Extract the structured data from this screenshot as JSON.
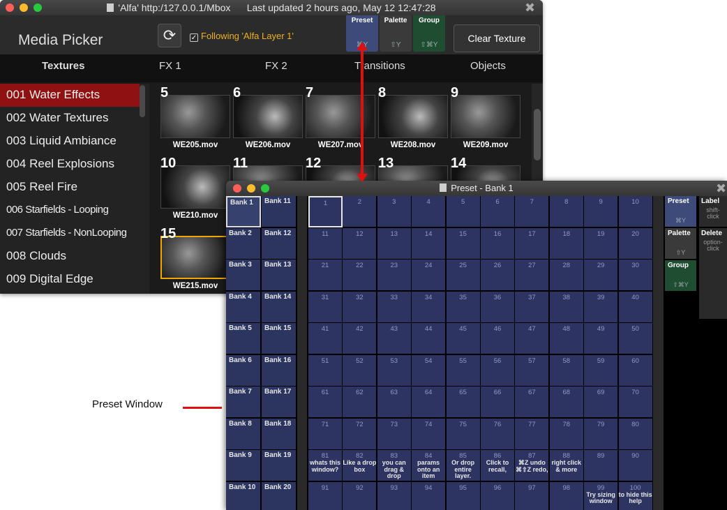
{
  "media_picker": {
    "window_title": "'Alfa' http:/127.0.0.1/Mbox      Last updated 2 hours ago, May 12 12:47:28",
    "app_title": "Media Picker",
    "following_label": "Following 'Alfa Layer 1'",
    "mode_buttons": [
      {
        "label": "Preset",
        "shortcut": "⌘Y",
        "color": "#2e3461"
      },
      {
        "label": "Palette",
        "shortcut": "⇧Y",
        "color": "#3a3a3a"
      },
      {
        "label": "Group",
        "shortcut": "⇧⌘Y",
        "color": "#1f4d32"
      }
    ],
    "clear_button": "Clear Texture",
    "tabs": [
      "Textures",
      "FX 1",
      "FX 2",
      "Transitions",
      "Objects"
    ],
    "sidebar": [
      "001  Water Effects",
      "002  Water Textures",
      "003  Liquid Ambiance",
      "004  Reel Explosions",
      "005  Reel Fire",
      "006  Starfields - Looping",
      "007  Starfields - NonLooping",
      "008  Clouds",
      "009  Digital Edge"
    ],
    "thumbnails": [
      {
        "num": "5",
        "file": "WE205.mov"
      },
      {
        "num": "6",
        "file": "WE206.mov"
      },
      {
        "num": "7",
        "file": "WE207.mov"
      },
      {
        "num": "8",
        "file": "WE208.mov"
      },
      {
        "num": "9",
        "file": "WE209.mov"
      },
      {
        "num": "10",
        "file": "WE210.mov"
      },
      {
        "num": "11",
        "file": ""
      },
      {
        "num": "12",
        "file": ""
      },
      {
        "num": "13",
        "file": ""
      },
      {
        "num": "14",
        "file": ""
      },
      {
        "num": "15",
        "file": "WE215.mov"
      }
    ]
  },
  "preset_window": {
    "title": "Preset - Bank 1",
    "banks_left": [
      "Bank 1",
      "Bank 2",
      "Bank 3",
      "Bank 4",
      "Bank 5",
      "Bank 6",
      "Bank 7",
      "Bank 8",
      "Bank 9",
      "Bank 10"
    ],
    "banks_right": [
      "Bank 11",
      "Bank 12",
      "Bank 13",
      "Bank 14",
      "Bank 15",
      "Bank 16",
      "Bank 17",
      "Bank 18",
      "Bank 19",
      "Bank 20"
    ],
    "help_texts": {
      "81": "whats this window?",
      "82": "Like a drop box",
      "83": "you can drag & drop",
      "84": "params onto an item",
      "85": "Or drop entire layer.",
      "86": "Click to recall,",
      "87": "⌘Z undo ⌘⇧Z redo,",
      "88": "right click & more",
      "99": "Try sizing window",
      "100": "to hide this help"
    },
    "right_buttons": [
      {
        "label": "Preset",
        "shortcut": "⌘Y",
        "color": "#2e3461"
      },
      {
        "label": "Palette",
        "shortcut": "⇧Y",
        "color": "#3a3a3a"
      },
      {
        "label": "Group",
        "shortcut": "⇧⌘Y",
        "color": "#1f4d32"
      }
    ],
    "side_actions": [
      {
        "label": "Label",
        "hint": "shift-click"
      },
      {
        "label": "Delete",
        "hint": "option-click"
      }
    ]
  },
  "annotation": {
    "callout": "Preset Window"
  }
}
